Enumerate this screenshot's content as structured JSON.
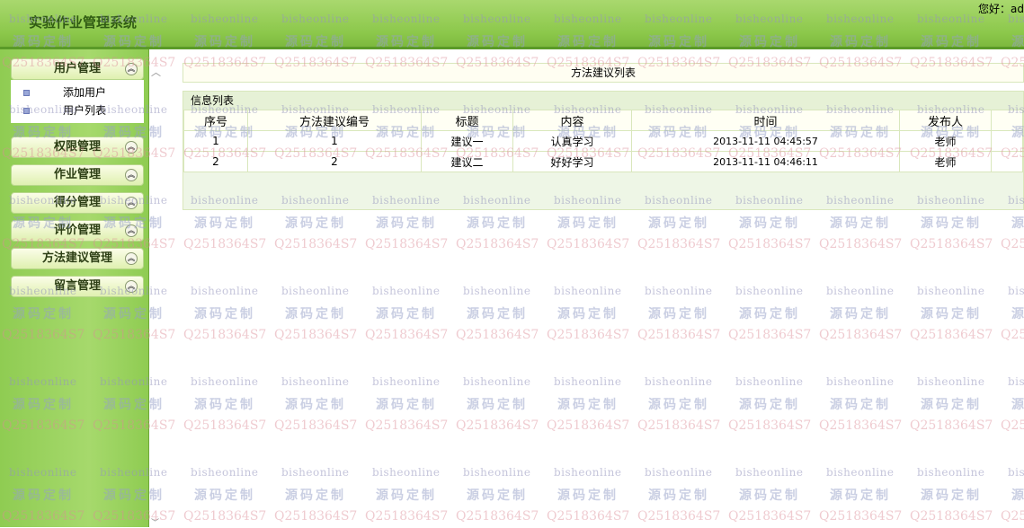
{
  "header": {
    "title": "实验作业管理系统",
    "greeting": "您好：ad"
  },
  "sidebar": {
    "groups": [
      {
        "label": "用户管理",
        "items": [
          "添加用户",
          "用户列表"
        ]
      },
      {
        "label": "权限管理"
      },
      {
        "label": "作业管理"
      },
      {
        "label": "得分管理"
      },
      {
        "label": "评价管理"
      },
      {
        "label": "方法建议管理"
      },
      {
        "label": "留言管理"
      }
    ]
  },
  "main": {
    "list_title": "方法建议列表",
    "panel_caption": "信息列表",
    "columns": [
      "序号",
      "方法建议编号",
      "标题",
      "内容",
      "时间",
      "发布人"
    ],
    "rows": [
      [
        "1",
        "1",
        "建议一",
        "认真学习",
        "2013-11-11 04:45:57",
        "老师"
      ],
      [
        "2",
        "2",
        "建议二",
        "好好学习",
        "2013-11-11 04:46:11",
        "老师"
      ]
    ]
  },
  "watermark": {
    "line1": "bisheonline",
    "line2": "源码定制",
    "line3": "Q2518364S7"
  },
  "icons": {
    "chevron": "chevron-up-double-icon",
    "scroll_up": "scroll-up-icon",
    "scroll_down": "scroll-down-icon",
    "bullet": "square-bullet-icon"
  },
  "colors": {
    "header_green": "#8cc84b",
    "sidebar_green": "#a6d96c",
    "table_border": "#d9e7bc"
  }
}
